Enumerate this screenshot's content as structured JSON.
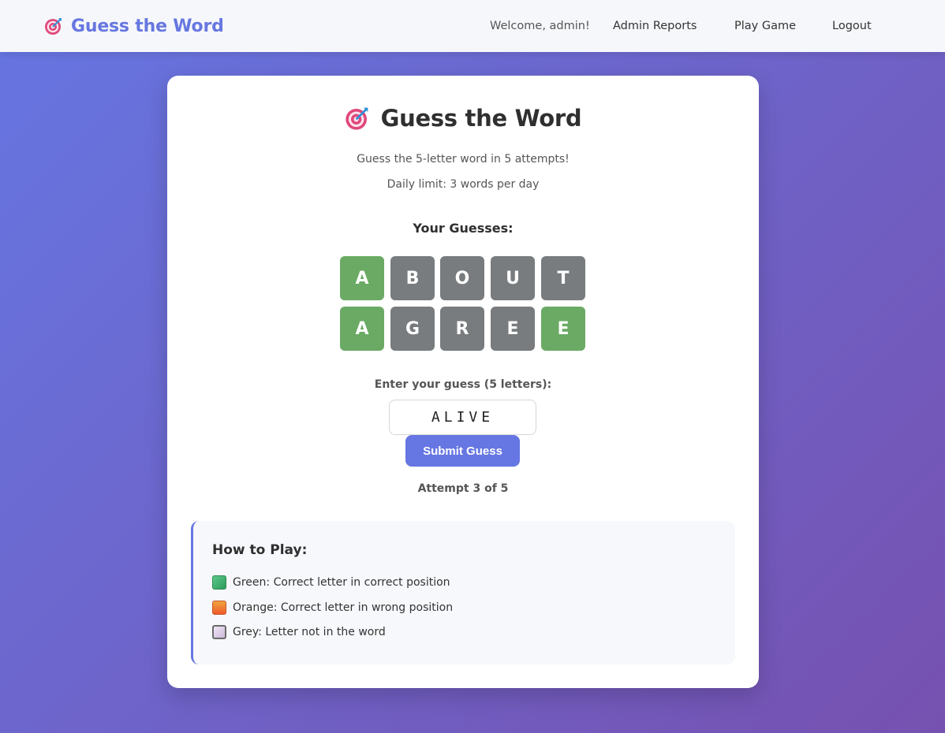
{
  "navbar": {
    "brand_title": "Guess the Word",
    "welcome": "Welcome, admin!",
    "links": [
      "Admin Reports",
      "Play Game",
      "Logout"
    ]
  },
  "game": {
    "title": "Guess the Word",
    "subtitle": "Guess the 5-letter word in 5 attempts!",
    "daily_limit": "Daily limit: 3 words per day",
    "guesses_heading": "Your Guesses:",
    "guesses": [
      {
        "letters": [
          "A",
          "B",
          "O",
          "U",
          "T"
        ],
        "states": [
          "correct",
          "absent",
          "absent",
          "absent",
          "absent"
        ]
      },
      {
        "letters": [
          "A",
          "G",
          "R",
          "E",
          "E"
        ],
        "states": [
          "correct",
          "absent",
          "absent",
          "absent",
          "correct"
        ]
      }
    ],
    "input_label": "Enter your guess (5 letters):",
    "input_value": "ALIVE",
    "submit_label": "Submit Guess",
    "attempt_text": "Attempt 3 of 5"
  },
  "how_to_play": {
    "title": "How to Play:",
    "items": [
      {
        "color": "green",
        "text": "Green: Correct letter in correct position"
      },
      {
        "color": "orange",
        "text": "Orange: Correct letter in wrong position"
      },
      {
        "color": "grey",
        "text": "Grey: Letter not in the word"
      }
    ]
  },
  "colors": {
    "accent": "#6676e2",
    "correct": "#6aaa64",
    "absent": "#787c7e",
    "present": "#e3843b"
  },
  "icons": {
    "brand": "target-dart-icon",
    "title": "target-dart-icon"
  }
}
